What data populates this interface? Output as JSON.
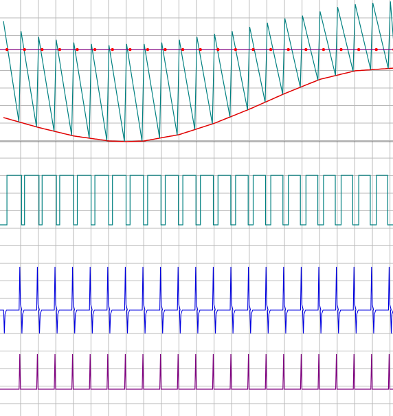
{
  "colors": {
    "background": "#ffffff",
    "grid": "#b8b8b8",
    "axis": "#6e6e6e",
    "sawtooth": "#008080",
    "envelope": "#e00000",
    "level": "#800080",
    "marker": "#ff0000",
    "square": "#008080",
    "current": "#0000e0",
    "pulse": "#800080"
  },
  "chart_data": [
    {
      "type": "line",
      "title": "",
      "grid": true,
      "x_range": [
        0,
        22.3
      ],
      "y_range": [
        0,
        1
      ],
      "series": [
        {
          "kind": "sawtooth",
          "color": "#008080",
          "period": 1.0,
          "peaks": [
            0.85,
            0.78,
            0.74,
            0.72,
            0.7,
            0.69,
            0.68,
            0.69,
            0.69,
            0.7,
            0.72,
            0.74,
            0.76,
            0.78,
            0.81,
            0.84,
            0.87,
            0.89,
            0.92,
            0.95,
            0.97,
            0.98,
            0.99
          ]
        },
        {
          "kind": "envelope",
          "color": "#e00000",
          "points": [
            [
              0,
              0.17
            ],
            [
              2,
              0.1
            ],
            [
              4,
              0.04
            ],
            [
              6,
              0.005
            ],
            [
              7,
              0.0
            ],
            [
              8,
              0.005
            ],
            [
              10,
              0.05
            ],
            [
              12,
              0.13
            ],
            [
              14,
              0.23
            ],
            [
              16,
              0.34
            ],
            [
              18,
              0.44
            ],
            [
              20,
              0.5
            ],
            [
              22.3,
              0.52
            ]
          ]
        },
        {
          "kind": "level",
          "color": "#800080",
          "y": 0.65,
          "markers_every": 1.0
        }
      ]
    },
    {
      "type": "line",
      "title": "",
      "grid": true,
      "x_range": [
        0,
        22.3
      ],
      "y_range": [
        0,
        1
      ],
      "series": [
        {
          "kind": "square",
          "color": "#008080",
          "high": 1.0,
          "low": 0.0,
          "period": 1.0,
          "duty": [
            0.22,
            0.26,
            0.3,
            0.35,
            0.38,
            0.4,
            0.42,
            0.45,
            0.48,
            0.5,
            0.52,
            0.55,
            0.58,
            0.62,
            0.66,
            0.7,
            0.72,
            0.75,
            0.78,
            0.8,
            0.82,
            0.84,
            0.85
          ]
        }
      ]
    },
    {
      "type": "line",
      "title": "",
      "grid": true,
      "x_range": [
        0,
        22.3
      ],
      "y_range": [
        -1,
        1
      ],
      "series": [
        {
          "kind": "spikes",
          "color": "#0000e0",
          "period": 1.0,
          "positive_peak": 0.95,
          "negative_peak": -0.95,
          "baseline": 0.0
        }
      ]
    },
    {
      "type": "line",
      "title": "",
      "grid": true,
      "x_range": [
        0,
        22.3
      ],
      "y_range": [
        0,
        1
      ],
      "series": [
        {
          "kind": "pulses",
          "color": "#800080",
          "period": 1.0,
          "peak": 1.0
        }
      ]
    }
  ]
}
